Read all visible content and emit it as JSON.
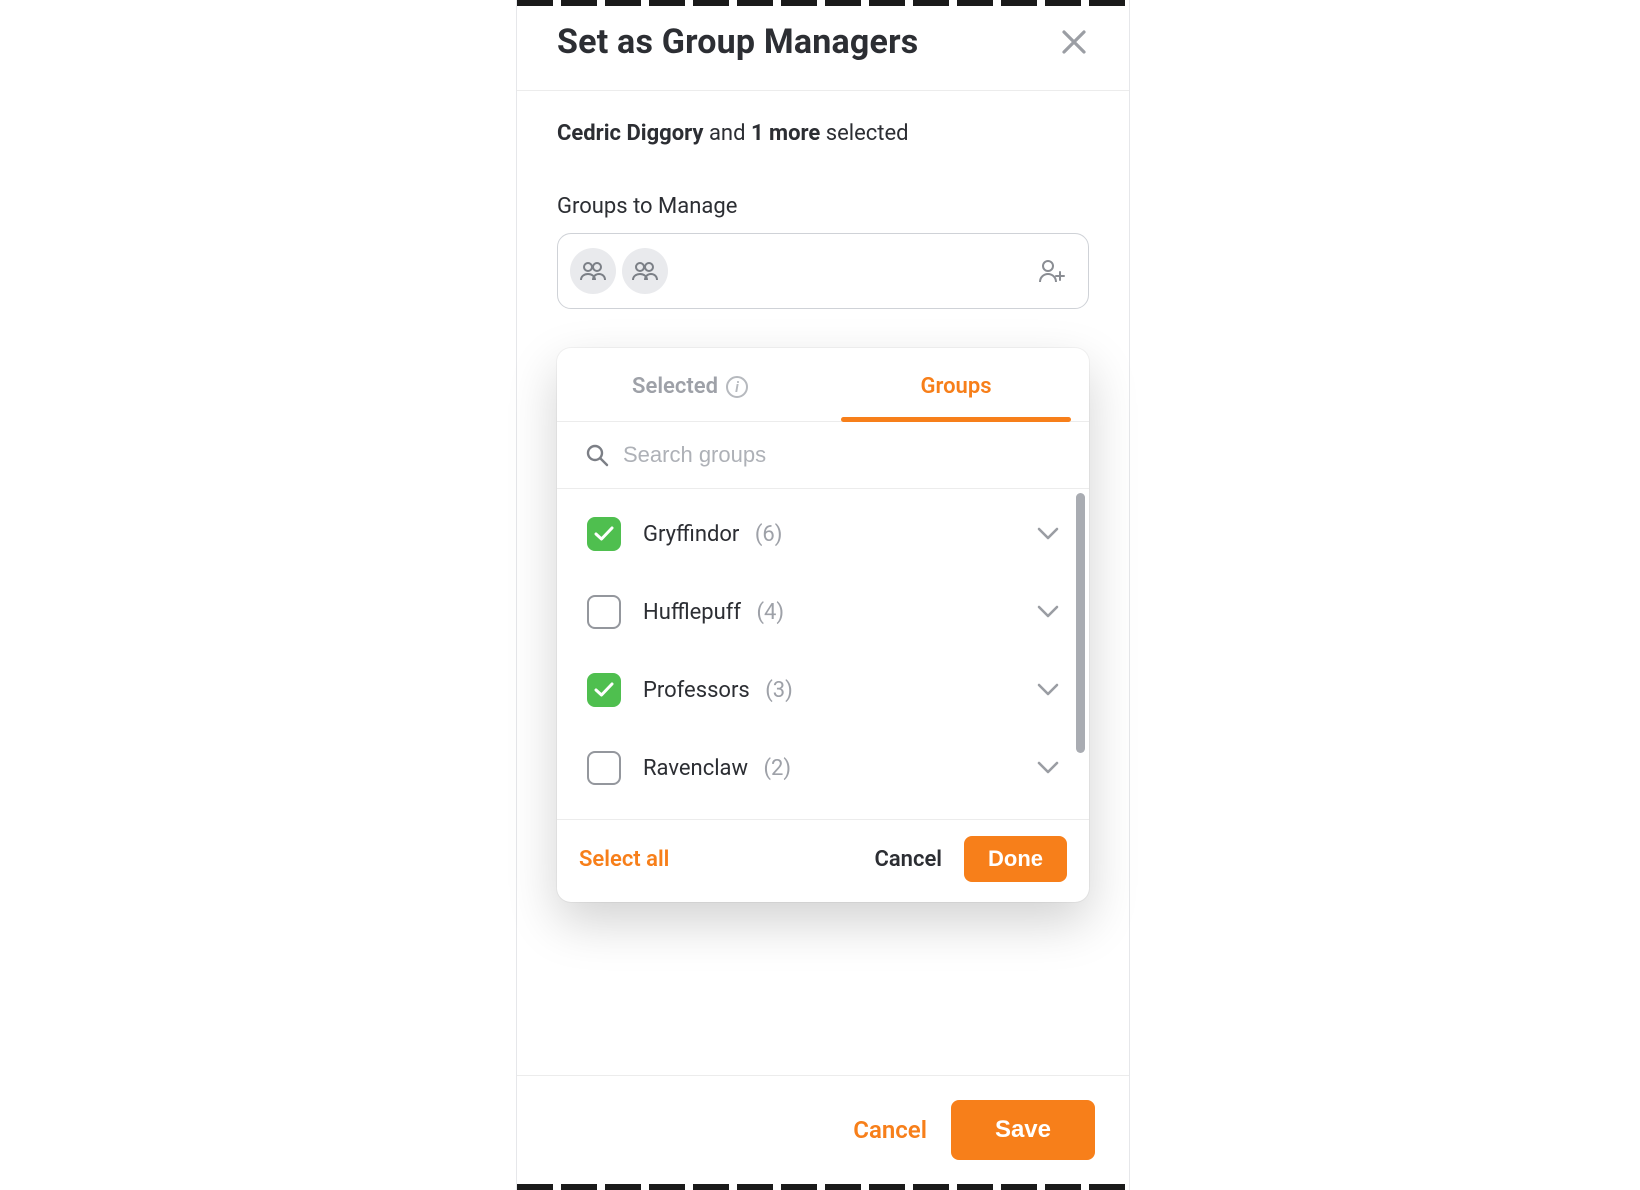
{
  "header": {
    "title": "Set as Group Managers"
  },
  "selection": {
    "name": "Cedric Diggory",
    "connector": "and",
    "more_count": "1 more",
    "suffix": "selected"
  },
  "groups_field": {
    "label": "Groups to Manage"
  },
  "popover": {
    "tabs": {
      "selected_label": "Selected",
      "groups_label": "Groups"
    },
    "search": {
      "placeholder": "Search groups"
    },
    "items": [
      {
        "name": "Gryffindor",
        "count": "(6)",
        "checked": true
      },
      {
        "name": "Hufflepuff",
        "count": "(4)",
        "checked": false
      },
      {
        "name": "Professors",
        "count": "(3)",
        "checked": true
      },
      {
        "name": "Ravenclaw",
        "count": "(2)",
        "checked": false
      }
    ],
    "footer": {
      "select_all": "Select all",
      "cancel": "Cancel",
      "done": "Done"
    }
  },
  "footer": {
    "cancel": "Cancel",
    "save": "Save"
  }
}
